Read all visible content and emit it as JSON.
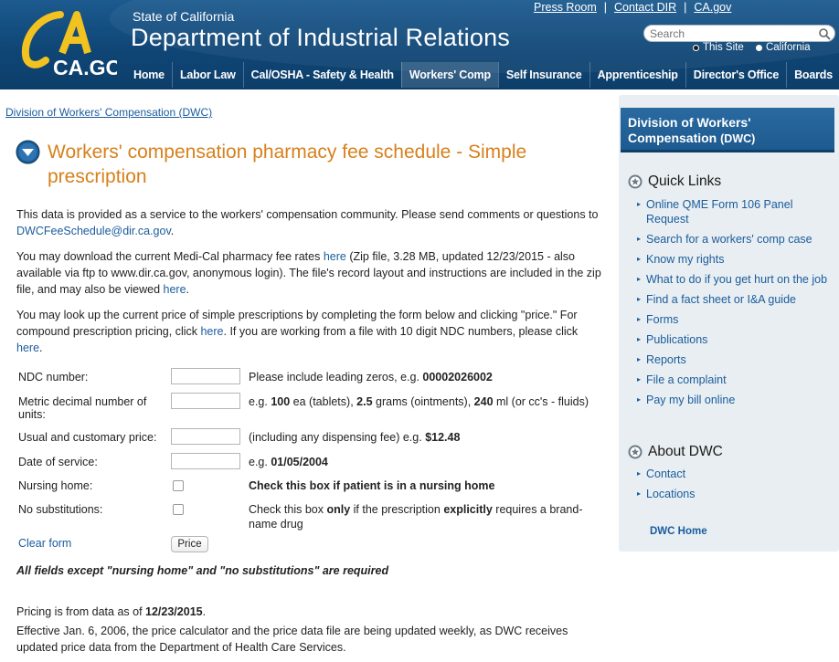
{
  "header": {
    "state_text": "State of California",
    "dept_title": "Department of Industrial Relations",
    "logo_text": "CA.GOV",
    "top_links": [
      "Press Room",
      "Contact DIR",
      "CA.gov"
    ],
    "top_link_separator": "|",
    "search": {
      "placeholder": "Search",
      "value": ""
    },
    "scope_options": [
      "This Site",
      "California"
    ],
    "nav": [
      "Home",
      "Labor Law",
      "Cal/OSHA - Safety & Health",
      "Workers' Comp",
      "Self Insurance",
      "Apprenticeship",
      "Director's Office",
      "Boards"
    ]
  },
  "breadcrumb": "Division of Workers' Compensation (DWC)",
  "page_title": "Workers' compensation pharmacy fee schedule - Simple prescription",
  "intro": {
    "p1_text": "This data is provided as a service to the workers' compensation community. Please send comments or questions to ",
    "p1_email": "DWCFeeSchedule@dir.ca.gov",
    "p1_end": ".",
    "p2_a": "You may download the current Medi-Cal pharmacy fee rates ",
    "p2_link1": "here",
    "p2_b": " (Zip file, 3.28 MB, updated 12/23/2015 - also available via ftp to www.dir.ca.gov, anonymous login). The file's record layout and instructions are included in the zip file, and may also be viewed ",
    "p2_link2": "here",
    "p2_end": ".",
    "p3_a": "You may look up the current price of simple prescriptions by completing the form below and clicking \"price.\" For compound prescription pricing, click ",
    "p3_link1": "here",
    "p3_b": ". If you are working from a file with 10 digit NDC numbers, please click ",
    "p3_link2": "here",
    "p3_end": "."
  },
  "form": {
    "ndc": {
      "label": "NDC number:",
      "hint_a": "Please include leading zeros, e.g. ",
      "hint_b": "00002026002"
    },
    "metric": {
      "label": "Metric decimal number of units:",
      "hint_1": "e.g. ",
      "hint_2": "100",
      "hint_3": " ea (tablets), ",
      "hint_4": "2.5",
      "hint_5": " grams (ointments), ",
      "hint_6": "240",
      "hint_7": " ml (or cc's - fluids)"
    },
    "usual": {
      "label": "Usual and customary price:",
      "hint_a": "(including any dispensing fee) e.g. ",
      "hint_b": "$12.48"
    },
    "date": {
      "label": "Date of service:",
      "hint_a": "e.g. ",
      "hint_b": "01/05/2004"
    },
    "nursing": {
      "label": "Nursing home:",
      "hint": "Check this box if patient is in a nursing home",
      "checked": false
    },
    "nosub": {
      "label": "No substitutions:",
      "hint_a": "Check this box ",
      "hint_b": "only",
      "hint_c": " if the prescription ",
      "hint_d": "explicitly",
      "hint_e": " requires a brand-name drug",
      "checked": false
    },
    "clear_label": "Clear form",
    "price_label": "Price",
    "required_note": "All fields except \"nursing home\" and \"no substitutions\" are required"
  },
  "footer_notes": {
    "pricing_a": "Pricing is from data as of ",
    "pricing_date": "12/23/2015",
    "pricing_end": ".",
    "effective": "Effective Jan. 6, 2006, the price calculator and the price data file are being updated weekly, as DWC receives updated price data from the Department of Health Care Services."
  },
  "sidebar": {
    "header_a": "Division of Workers'",
    "header_b": "Compensation ",
    "header_c": "(DWC)",
    "quick_links_title": "Quick Links",
    "quick_links": [
      "Online QME Form 106 Panel Request",
      "Search for a workers' comp case",
      "Know my rights",
      "What to do if you get hurt on the job",
      "Find a fact sheet or I&A guide",
      "Forms",
      "Publications",
      "Reports",
      "File a complaint",
      "Pay my bill online"
    ],
    "about_title": "About DWC",
    "about_links": [
      "Contact",
      "Locations"
    ],
    "home_link": "DWC Home"
  },
  "colors": {
    "header_blue": "#0f4676",
    "title_orange": "#d7801c",
    "link_blue": "#1a5c9e",
    "sidebar_bg": "#e8eef1"
  },
  "icons": {
    "title": "down-arrow-circle-icon",
    "section": "star-badge-icon",
    "search": "search-icon",
    "bullet": "right-triangle-icon"
  }
}
